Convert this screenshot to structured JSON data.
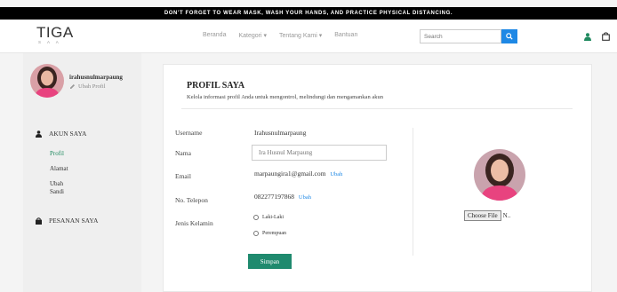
{
  "announcement": "DON'T FORGET TO WEAR MASK, WASH YOUR HANDS, AND PRACTICE PHYSICAL DISTANCING.",
  "logo": {
    "main": "TIGA",
    "sub": "S A A"
  },
  "nav": {
    "home": "Beranda",
    "category": "Kategori ▾",
    "about": "Tentang Kami ▾",
    "help": "Bantuan"
  },
  "search": {
    "placeholder": "Search"
  },
  "sidebar": {
    "username": "irahusnulmarpaung",
    "edit_profile": "Ubah Profil",
    "account_heading": "AKUN SAYA",
    "profile_link": "Profil",
    "address_link": "Alamat",
    "password_link_1": "Ubah",
    "password_link_2": "Sandi",
    "orders_heading": "PESANAN SAYA"
  },
  "profile": {
    "title": "PROFIL SAYA",
    "subtitle": "Kelola informasi profil Anda untuk mengontrol, melindungi dan mengamankan akun",
    "username_label": "Username",
    "username_value": "Irahusnulmarpaung",
    "name_label": "Nama",
    "name_value": "Ira Husnul Marpaung",
    "email_label": "Email",
    "email_value": "marpaungira1@gmail.com",
    "email_change": "Ubah",
    "phone_label": "No. Telepon",
    "phone_value": "082277197868",
    "phone_change": "Ubah",
    "gender_label": "Jenis Kelamin",
    "gender_options": [
      "Laki-Laki",
      "Perempuan"
    ],
    "save_label": "Simpan",
    "choose_file": "Choose File",
    "file_status": "N.."
  },
  "colors": {
    "accent_green": "#1f8a6e",
    "link_blue": "#1e88e5",
    "topbar": "#000000"
  },
  "icons": [
    "search-icon",
    "user-icon",
    "shopping-bag-icon",
    "pencil-icon",
    "person-icon",
    "bag-icon"
  ]
}
